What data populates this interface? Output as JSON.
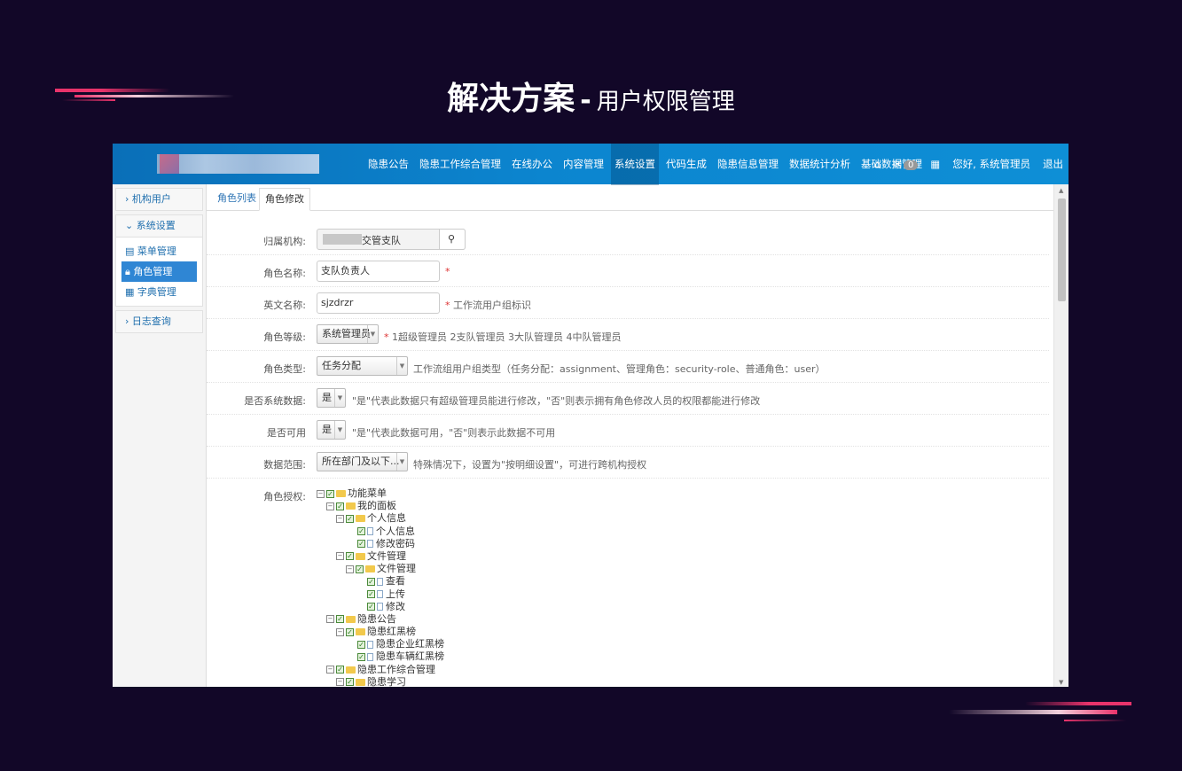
{
  "slide": {
    "title_main": "解决方案",
    "title_sep": "-",
    "title_sub": "用户权限管理"
  },
  "topbar": {
    "nav": [
      "隐患公告",
      "隐患工作综合管理",
      "在线办公",
      "内容管理",
      "系统设置",
      "代码生成",
      "隐患信息管理",
      "数据统计分析",
      "基础数据管理"
    ],
    "active_nav": "系统设置",
    "message_count": "0",
    "greeting": "您好, 系统管理员",
    "logout": "退出",
    "icons": [
      "home-icon",
      "mail-icon",
      "grid-icon"
    ]
  },
  "sidebar": {
    "group1": "机构用户",
    "group2": "系统设置",
    "items": [
      "菜单管理",
      "角色管理",
      "字典管理"
    ],
    "active_item": "角色管理",
    "group3": "日志查询"
  },
  "tabs": {
    "list": "角色列表",
    "edit": "角色修改"
  },
  "form": {
    "org_label": "归属机构:",
    "org_value": "交管支队",
    "name_label": "角色名称:",
    "name_value": "支队负责人",
    "en_label": "英文名称:",
    "en_value": "sjzdrzr",
    "en_hint": "工作流用户组标识",
    "level_label": "角色等级:",
    "level_value": "系统管理员",
    "level_hint": "1超级管理员 2支队管理员 3大队管理员 4中队管理员",
    "type_label": "角色类型:",
    "type_value": "任务分配",
    "type_hint": "工作流组用户组类型（任务分配：assignment、管理角色：security-role、普通角色：user）",
    "sys_label": "是否系统数据:",
    "sys_value": "是",
    "sys_hint": "\"是\"代表此数据只有超级管理员能进行修改，\"否\"则表示拥有角色修改人员的权限都能进行修改",
    "usable_label": "是否可用",
    "usable_value": "是",
    "usable_hint": "\"是\"代表此数据可用，\"否\"则表示此数据不可用",
    "scope_label": "数据范围:",
    "scope_value": "所在部门及以下...",
    "scope_hint": "特殊情况下，设置为\"按明细设置\"，可进行跨机构授权",
    "auth_label": "角色授权:",
    "required_mark": "*"
  },
  "tree": [
    {
      "label": "功能菜单",
      "level": 0,
      "kind": "folder",
      "expand": true
    },
    {
      "label": "我的面板",
      "level": 1,
      "kind": "folder",
      "expand": true
    },
    {
      "label": "个人信息",
      "level": 2,
      "kind": "folder",
      "expand": true
    },
    {
      "label": "个人信息",
      "level": 3,
      "kind": "doc"
    },
    {
      "label": "修改密码",
      "level": 3,
      "kind": "doc"
    },
    {
      "label": "文件管理",
      "level": 2,
      "kind": "folder",
      "expand": true
    },
    {
      "label": "文件管理",
      "level": 3,
      "kind": "folder",
      "expand": true
    },
    {
      "label": "查看",
      "level": 4,
      "kind": "doc"
    },
    {
      "label": "上传",
      "level": 4,
      "kind": "doc"
    },
    {
      "label": "修改",
      "level": 4,
      "kind": "doc"
    },
    {
      "label": "隐患公告",
      "level": 1,
      "kind": "folder",
      "expand": true
    },
    {
      "label": "隐患红黑榜",
      "level": 2,
      "kind": "folder",
      "expand": true
    },
    {
      "label": "隐患企业红黑榜",
      "level": 3,
      "kind": "doc"
    },
    {
      "label": "隐患车辆红黑榜",
      "level": 3,
      "kind": "doc"
    },
    {
      "label": "隐患工作综合管理",
      "level": 1,
      "kind": "folder",
      "expand": true
    },
    {
      "label": "隐患学习",
      "level": 2,
      "kind": "folder",
      "expand": true
    }
  ]
}
